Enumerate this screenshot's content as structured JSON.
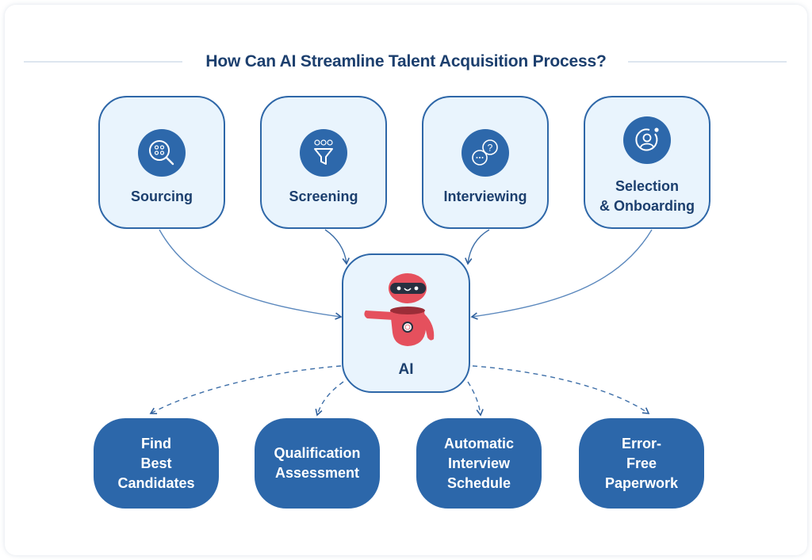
{
  "title": "How Can AI Streamline Talent Acquisition Process?",
  "stages": [
    {
      "label": "Sourcing",
      "icon": "magnifier-people-icon"
    },
    {
      "label": "Screening",
      "icon": "funnel-people-icon"
    },
    {
      "label": "Interviewing",
      "icon": "chat-bubbles-icon"
    },
    {
      "label_line1": "Selection",
      "label_line2": "& Onboarding",
      "icon": "user-gear-icon"
    }
  ],
  "center": {
    "label": "AI",
    "icon": "robot-icon"
  },
  "outcomes": [
    {
      "lines": [
        "Find",
        "Best",
        "Candidates"
      ]
    },
    {
      "lines": [
        "Qualification",
        "Assessment"
      ]
    },
    {
      "lines": [
        "Automatic",
        "Interview",
        "Schedule"
      ]
    },
    {
      "lines": [
        "Error-",
        "Free",
        "Paperwork"
      ]
    }
  ],
  "colors": {
    "primary": "#2c67aa",
    "title": "#1c3f6e",
    "card_bg": "#e9f4fd",
    "robot": "#e5505d",
    "robot_visor": "#283040"
  }
}
